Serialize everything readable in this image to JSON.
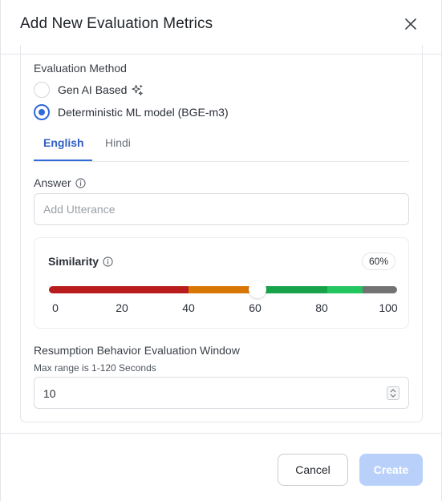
{
  "dialog": {
    "title": "Add New Evaluation Metrics"
  },
  "evaluation_method": {
    "label": "Evaluation Method",
    "options": [
      {
        "label": "Gen AI Based",
        "selected": false,
        "icon": "sparkle-icon"
      },
      {
        "label": "Deterministic ML model (BGE-m3)",
        "selected": true
      }
    ]
  },
  "tabs": [
    {
      "label": "English",
      "active": true
    },
    {
      "label": "Hindi",
      "active": false
    }
  ],
  "answer": {
    "label": "Answer",
    "placeholder": "Add Utterance",
    "value": ""
  },
  "similarity": {
    "label": "Similarity",
    "value_label": "60%",
    "value": 60,
    "min": 0,
    "max": 100,
    "ticks": [
      "0",
      "20",
      "40",
      "60",
      "80",
      "100"
    ],
    "segments": [
      {
        "from": 0,
        "to": 40,
        "color": "#b91c1c"
      },
      {
        "from": 40,
        "to": 60,
        "color": "#d97706"
      },
      {
        "from": 60,
        "to": 80,
        "color": "#16a34a"
      },
      {
        "from": 80,
        "to": 90,
        "color": "#22c55e"
      },
      {
        "from": 90,
        "to": 100,
        "color": "#737373"
      }
    ]
  },
  "window": {
    "label": "Resumption Behavior Evaluation Window",
    "hint": "Max range is 1-120 Seconds",
    "value": "10"
  },
  "footer": {
    "cancel_label": "Cancel",
    "create_label": "Create"
  },
  "colors": {
    "accent": "#2f6bd9",
    "create_disabled": "#b9d1fa"
  }
}
